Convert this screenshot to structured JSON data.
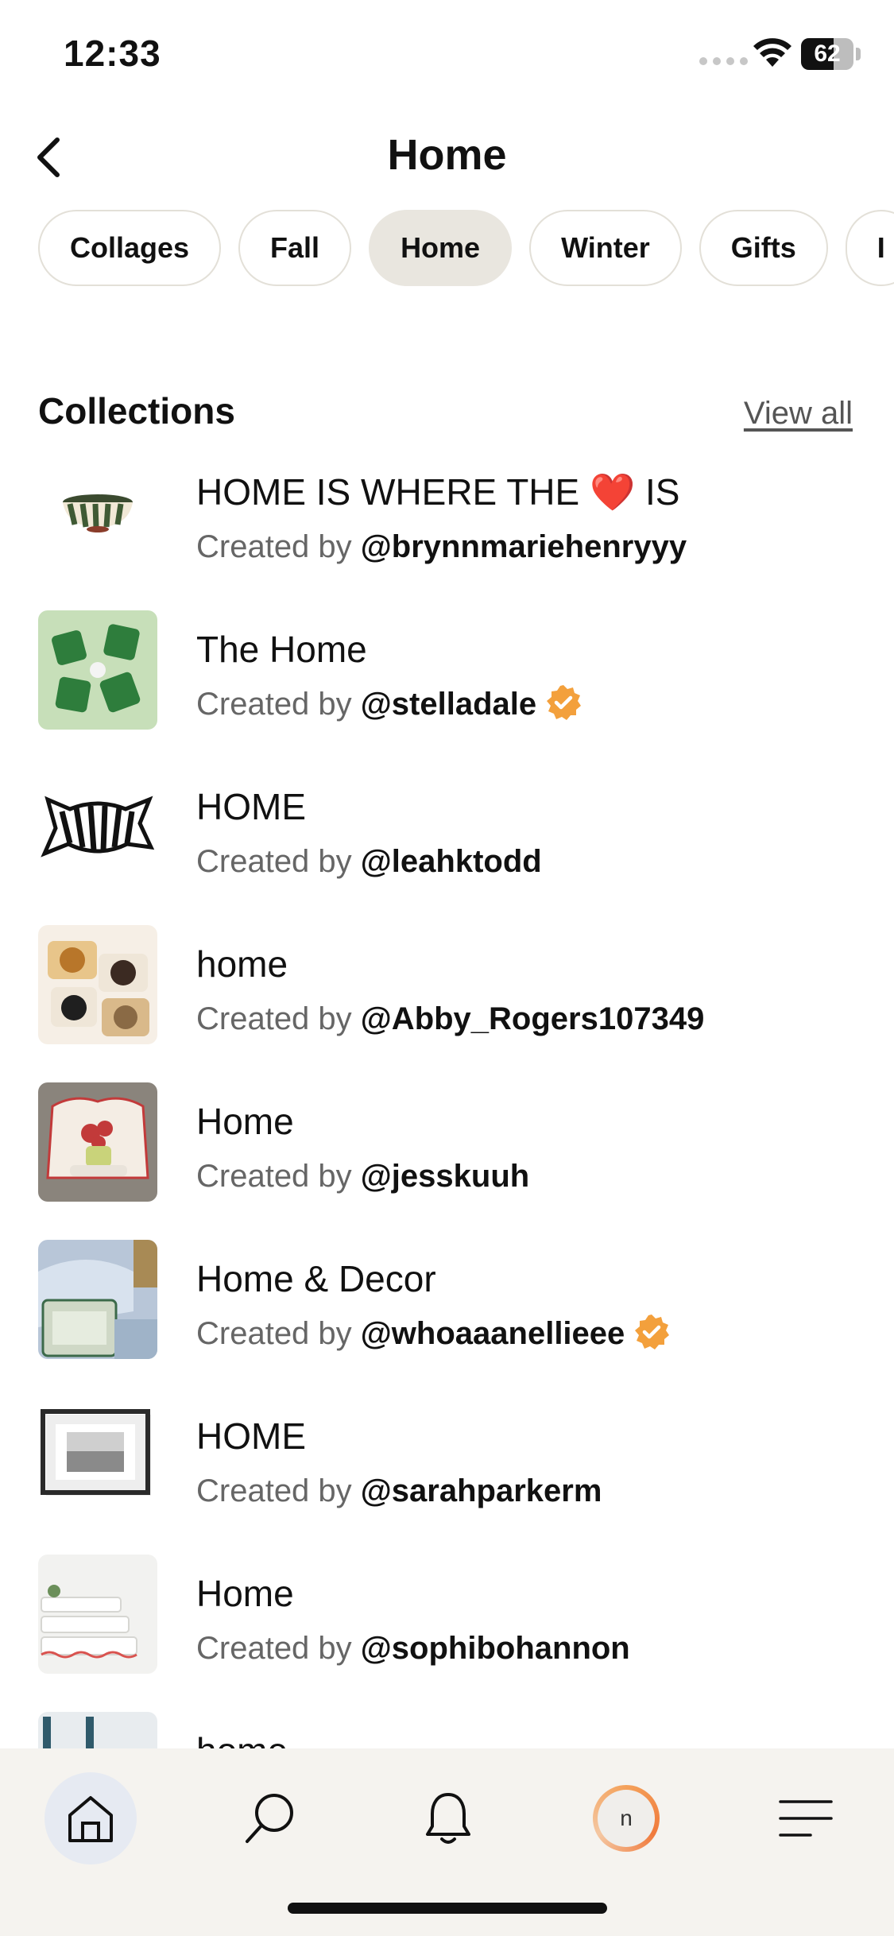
{
  "status": {
    "time": "12:33",
    "battery": "62"
  },
  "header": {
    "title": "Home"
  },
  "chips": [
    "Collages",
    "Fall",
    "Home",
    "Winter",
    "Gifts",
    "I"
  ],
  "active_chip": "Home",
  "collections": {
    "title": "Collections",
    "view_all": "View all",
    "created_by": "Created by",
    "items": [
      {
        "title": "HOME IS WHERE THE ❤️ IS",
        "handle": "@brynnmariehenryyy",
        "verified": false
      },
      {
        "title": "The Home",
        "handle": "@stelladale",
        "verified": true
      },
      {
        "title": "HOME",
        "handle": "@leahktodd",
        "verified": false
      },
      {
        "title": "home",
        "handle": "@Abby_Rogers107349",
        "verified": false
      },
      {
        "title": "Home",
        "handle": "@jesskuuh",
        "verified": false
      },
      {
        "title": "Home & Decor",
        "handle": "@whoaaanellieee",
        "verified": true
      },
      {
        "title": "HOME",
        "handle": "@sarahparkerm",
        "verified": false
      },
      {
        "title": "Home",
        "handle": "@sophibohannon",
        "verified": false
      },
      {
        "title": "home",
        "handle": "",
        "verified": false
      }
    ]
  },
  "nav": {
    "profile_initial": "n"
  },
  "colors": {
    "chip_active": "#e9e6df",
    "nav_bg": "#f5f3ef",
    "home_bubble": "#e6eaf2",
    "verified": "#f3a03c"
  }
}
